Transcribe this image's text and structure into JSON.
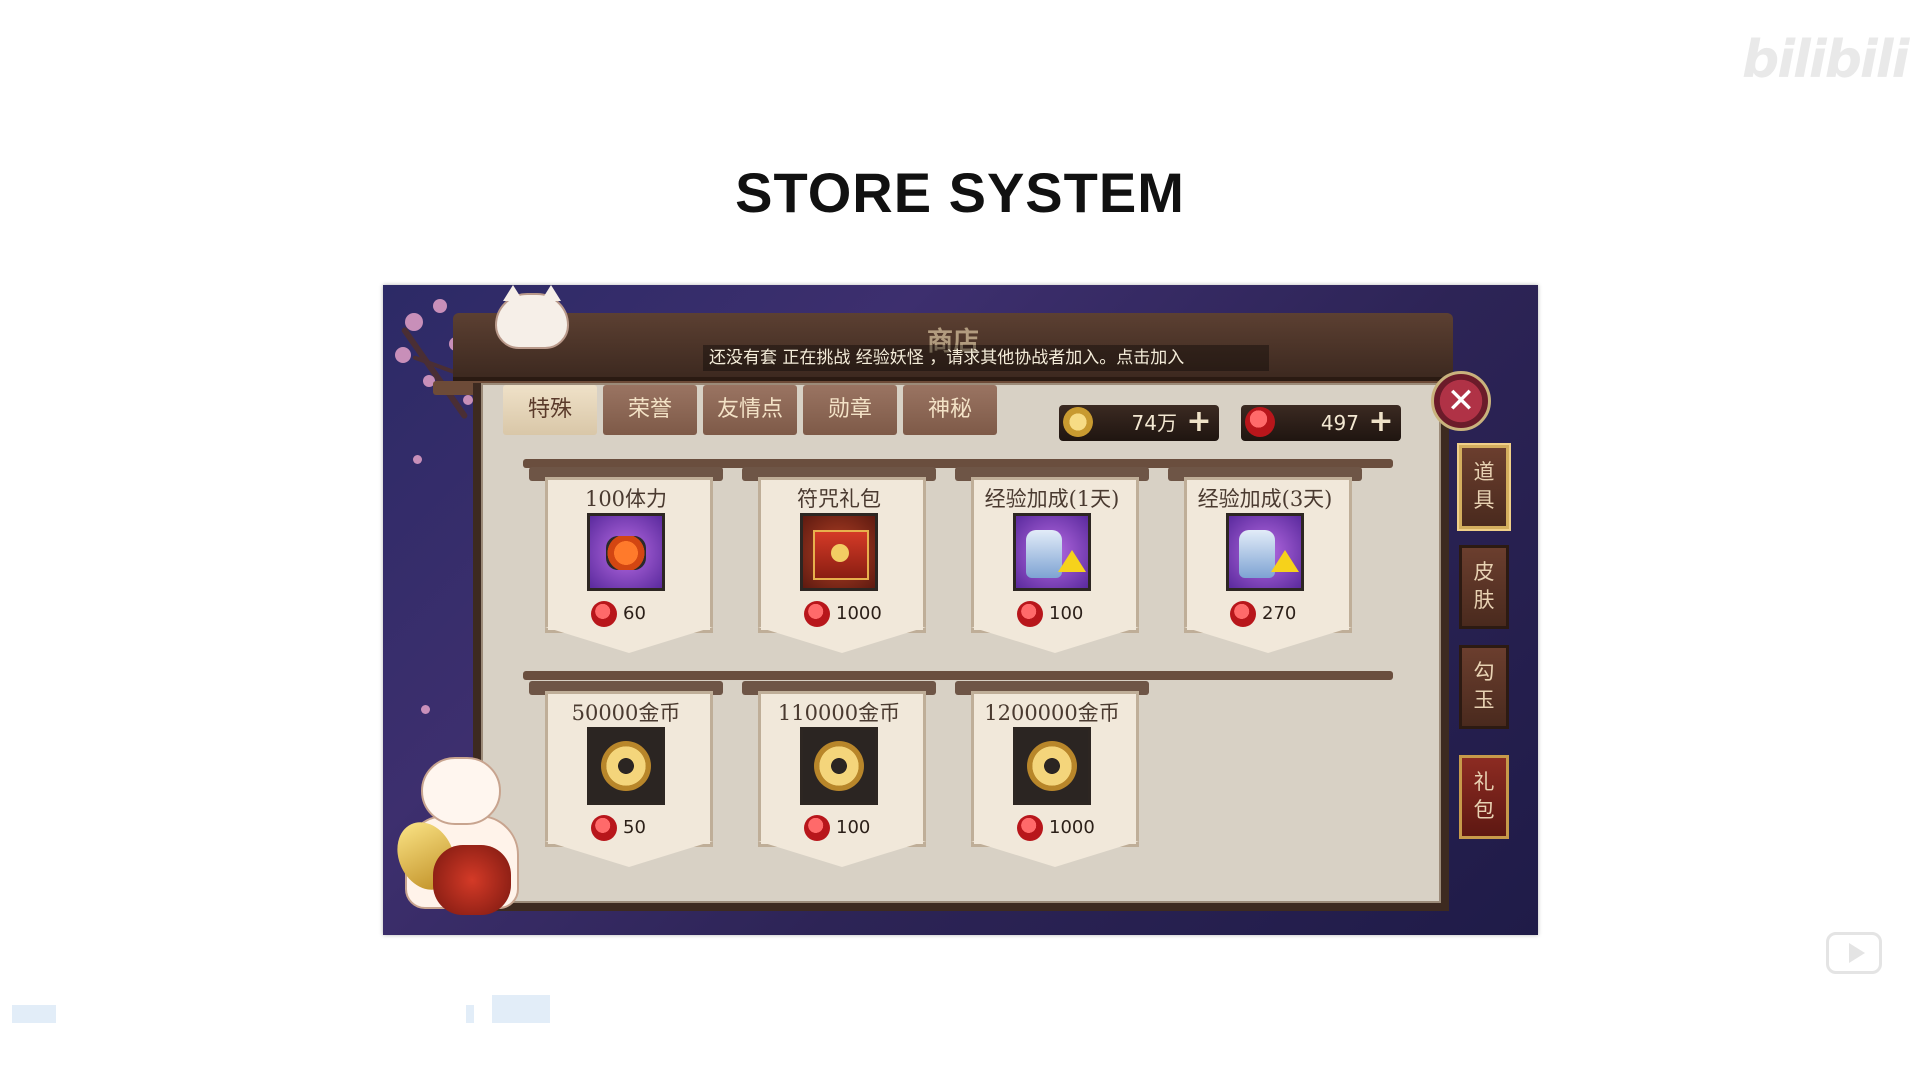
{
  "watermark": "bilibili",
  "slide": {
    "title": "STORE SYSTEM"
  },
  "game": {
    "roof_title": "商店",
    "marquee": "还没有套 正在挑战 经验妖怪 ，请求其他协战者加入。点击加入",
    "tabs": [
      {
        "label": "特殊",
        "active": true
      },
      {
        "label": "荣誉",
        "active": false
      },
      {
        "label": "友情点",
        "active": false
      },
      {
        "label": "勋章",
        "active": false
      },
      {
        "label": "神秘",
        "active": false
      }
    ],
    "currency": {
      "coins": {
        "value": "74万",
        "icon": "coin-icon"
      },
      "magatama": {
        "value": "497",
        "icon": "magatama-icon"
      }
    },
    "items_row1": [
      {
        "name": "100体力",
        "price": "60",
        "icon": "sushi-icon"
      },
      {
        "name": "符咒礼包",
        "price": "1000",
        "icon": "gift-box-icon"
      },
      {
        "name": "经验加成(1天)",
        "price": "100",
        "icon": "exp-bottle-icon"
      },
      {
        "name": "经验加成(3天)",
        "price": "270",
        "icon": "exp-bottle-icon"
      }
    ],
    "items_row2": [
      {
        "name": "50000金币",
        "price": "50",
        "icon": "gold-coin-icon"
      },
      {
        "name": "110000金币",
        "price": "100",
        "icon": "gold-coin-icon"
      },
      {
        "name": "1200000金币",
        "price": "1000",
        "icon": "gold-coin-icon"
      }
    ],
    "side_tabs": [
      {
        "label": "道具",
        "active": true
      },
      {
        "label": "皮肤",
        "active": false
      },
      {
        "label": "勾玉",
        "active": false
      },
      {
        "label": "礼包",
        "active": false
      }
    ],
    "close_icon": "close-icon"
  },
  "colors": {
    "panel": "#d8d1c5",
    "frame": "#3d2a20",
    "magatama_red": "#b8161b",
    "coin_gold": "#c89a30"
  }
}
